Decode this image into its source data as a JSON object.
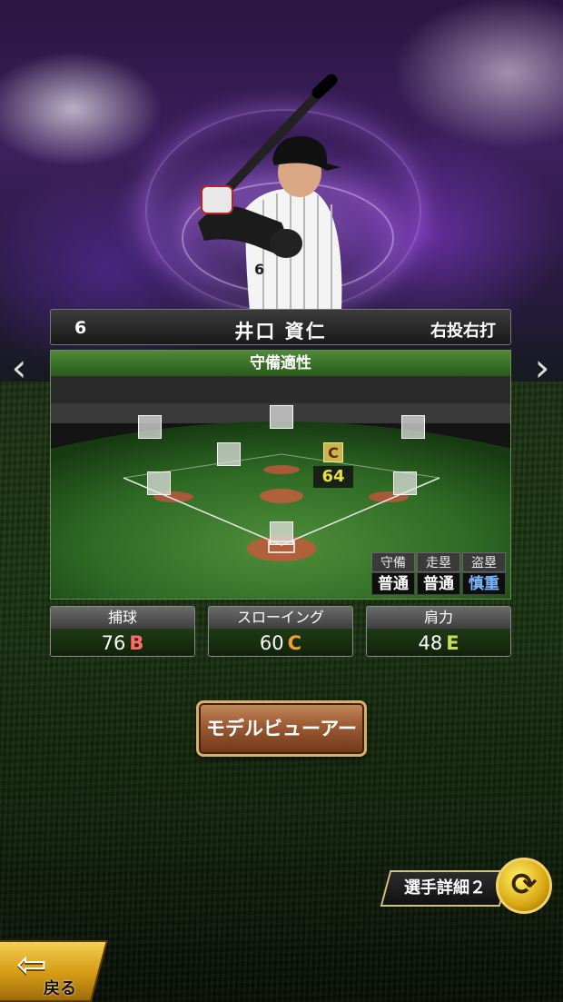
{
  "player": {
    "number": "6",
    "name": "井口 資仁",
    "handedness": "右投右打"
  },
  "defense": {
    "title": "守備適性",
    "position_grade": "C",
    "position_value": "64",
    "sub_headers": [
      "守備",
      "走塁",
      "盗塁"
    ],
    "sub_values": [
      "普通",
      "普通",
      "慎重"
    ],
    "sub_value_colors": [
      "#ffffff",
      "#ffffff",
      "#7db8ff"
    ]
  },
  "stats": [
    {
      "label": "捕球",
      "value": "76",
      "grade": "B",
      "grade_color": "#ff6b6b"
    },
    {
      "label": "スローイング",
      "value": "60",
      "grade": "C",
      "grade_color": "#f0a030"
    },
    {
      "label": "肩力",
      "value": "48",
      "grade": "E",
      "grade_color": "#c8e050"
    }
  ],
  "buttons": {
    "model_viewer": "モデルビューアー",
    "detail": "選手詳細２",
    "back": "戻る"
  },
  "icons": {
    "prev": "chevron-left-icon",
    "next": "chevron-right-icon",
    "switch": "refresh-icon",
    "back": "back-arrow-icon"
  }
}
